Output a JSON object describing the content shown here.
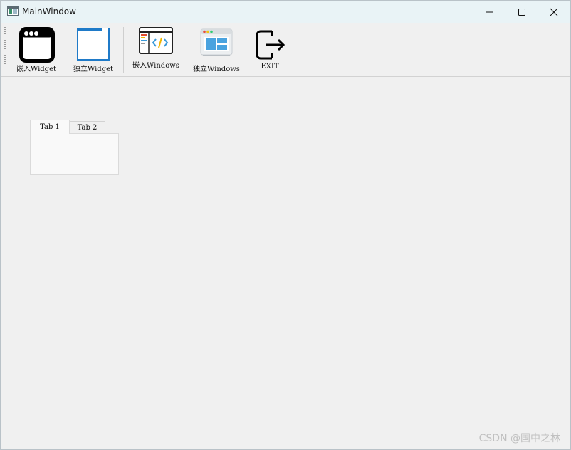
{
  "window": {
    "title": "MainWindow"
  },
  "toolbar": {
    "items": [
      {
        "label": "嵌入Widget",
        "icon": "window-black-icon"
      },
      {
        "label": "独立Widget",
        "icon": "window-blue-icon"
      },
      {
        "label": "嵌入Windows",
        "icon": "code-window-icon"
      },
      {
        "label": "独立Windows",
        "icon": "app-window-icon"
      },
      {
        "label": "EXIT",
        "icon": "exit-icon"
      }
    ]
  },
  "tabs": {
    "items": [
      {
        "label": "Tab 1"
      },
      {
        "label": "Tab 2"
      }
    ],
    "active": "Tab 1"
  },
  "watermark": "CSDN @国中之林",
  "colors": {
    "titlebar": "#e9f3f6",
    "background": "#f0f0f0",
    "accent_blue": "#1f7ac8"
  }
}
